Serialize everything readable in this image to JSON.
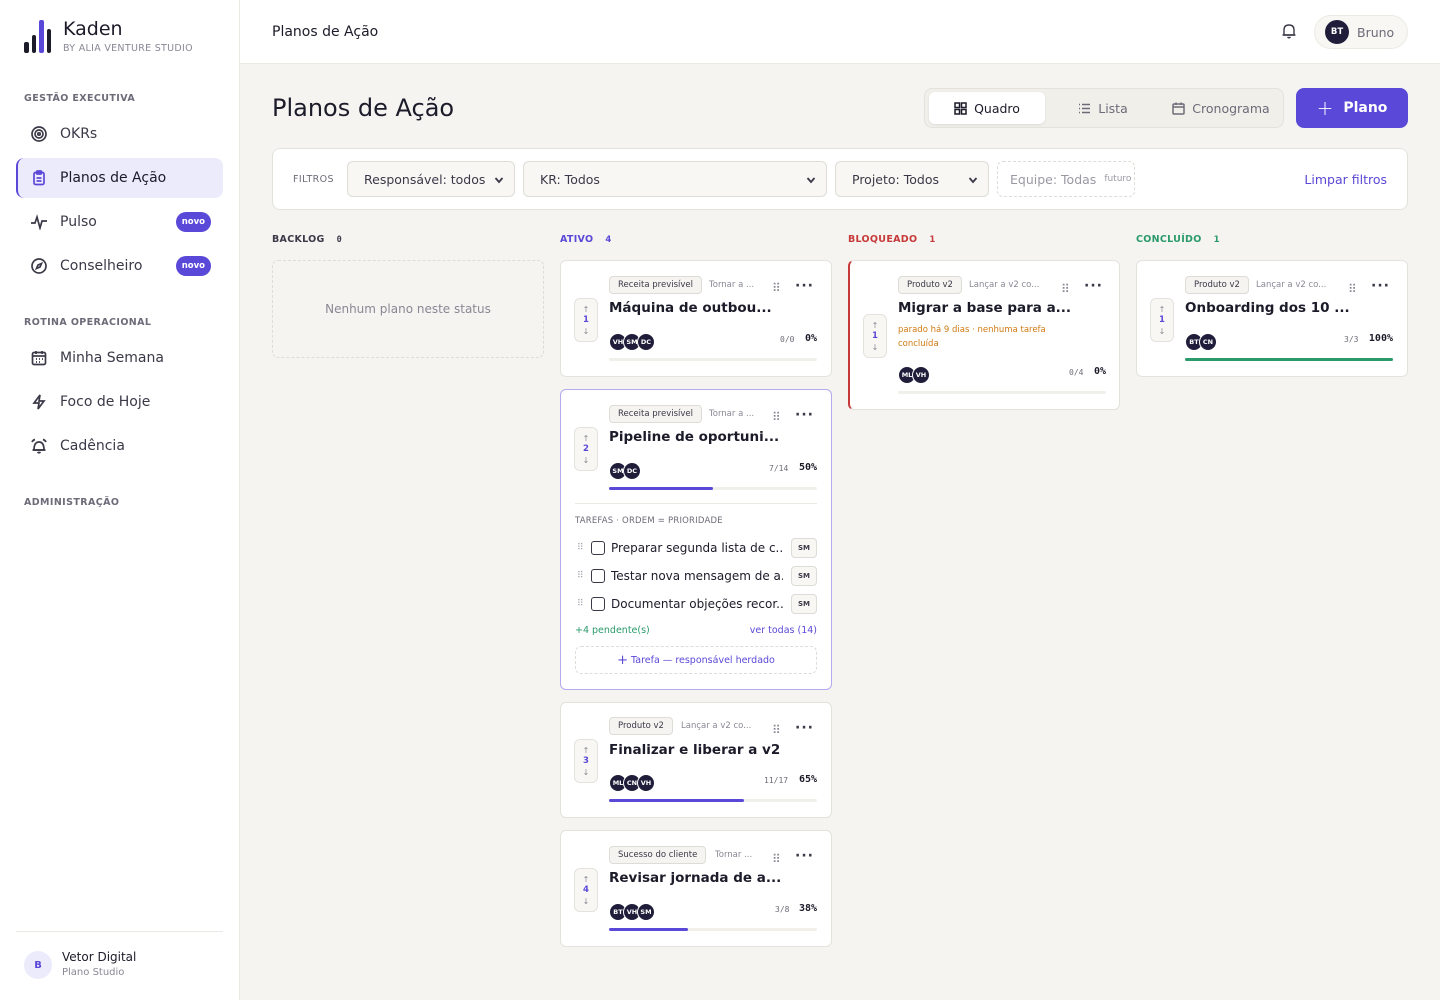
{
  "brand": {
    "name": "Kaden",
    "sub": "BY ALIA VENTURE STUDIO"
  },
  "sidebar": {
    "sections": [
      {
        "title": "GESTÃO EXECUTIVA"
      },
      {
        "title": "ROTINA OPERACIONAL"
      },
      {
        "title": "ADMINISTRAÇÃO"
      }
    ],
    "items": [
      {
        "label": "OKRs",
        "icon": "target-icon"
      },
      {
        "label": "Planos de Ação",
        "icon": "clipboard-icon",
        "active": true
      },
      {
        "label": "Pulso",
        "icon": "activity-icon",
        "badge": "novo"
      },
      {
        "label": "Conselheiro",
        "icon": "compass-icon",
        "badge": "novo"
      },
      {
        "label": "Minha Semana",
        "icon": "calendar-icon"
      },
      {
        "label": "Foco de Hoje",
        "icon": "lightning-icon"
      },
      {
        "label": "Cadência",
        "icon": "alarm-icon"
      }
    ],
    "footer": {
      "initial": "B",
      "name": "Vetor Digital",
      "sub": "Plano Studio"
    }
  },
  "topbar": {
    "breadcrumb": "Planos de Ação",
    "user_initials": "BT",
    "user_name": "Bruno"
  },
  "page": {
    "title": "Planos de Ação"
  },
  "views": {
    "board": "Quadro",
    "list": "Lista",
    "timeline": "Cronograma",
    "active": "Quadro"
  },
  "new_button": {
    "label": "Plano"
  },
  "filters": {
    "label": "FILTROS",
    "responsavel": "Responsável: todos",
    "kr": "KR: Todos",
    "projeto": "Projeto: Todos",
    "equipe": "Equipe: Todas",
    "equipe_tag": "futuro",
    "clear": "Limpar filtros"
  },
  "columns": [
    {
      "title": "BACKLOG",
      "count": "0",
      "color": "#3b3947",
      "empty_text": "Nenhum plano neste status"
    },
    {
      "title": "ATIVO",
      "count": "4",
      "color": "#5a48d8"
    },
    {
      "title": "BLOQUEADO",
      "count": "1",
      "color": "#c73a3a"
    },
    {
      "title": "CONCLUÍDO",
      "count": "1",
      "color": "#2a9a6a"
    }
  ],
  "cards": {
    "a1": {
      "priority": "1",
      "tag": "Receita previsível",
      "tag2": "Tornar a ...",
      "title": "Máquina de outbou...",
      "avatars": [
        "VH",
        "SM",
        "DC"
      ],
      "count": "0/0",
      "pct": "0%",
      "progress": 0
    },
    "a2": {
      "priority": "2",
      "tag": "Receita previsível",
      "tag2": "Tornar a ...",
      "title": "Pipeline de oportuni...",
      "avatars": [
        "SM",
        "DC"
      ],
      "count": "7/14",
      "pct": "50%",
      "progress": 0.5,
      "tasks_title": "TAREFAS · ORDEM = PRIORIDADE",
      "tasks": [
        {
          "text": "Preparar segunda lista de c...",
          "owner": "SM"
        },
        {
          "text": "Testar nova mensagem de a...",
          "owner": "SM"
        },
        {
          "text": "Documentar objeções recor...",
          "owner": "SM"
        }
      ],
      "pending": "+4 pendente(s)",
      "see_all": "ver todas (14)",
      "add_task": "Tarefa — responsável herdado"
    },
    "a3": {
      "priority": "3",
      "tag": "Produto v2",
      "tag2": "Lançar a v2 co...",
      "title": "Finalizar e liberar a v2",
      "avatars": [
        "ML",
        "CN",
        "VH"
      ],
      "count": "11/17",
      "pct": "65%",
      "progress": 0.65
    },
    "a4": {
      "priority": "4",
      "tag": "Sucesso do cliente",
      "tag2": "Tornar ...",
      "title": "Revisar jornada de a...",
      "avatars": [
        "BT",
        "VH",
        "SM"
      ],
      "count": "3/8",
      "pct": "38%",
      "progress": 0.38
    },
    "b1": {
      "priority": "1",
      "tag": "Produto v2",
      "tag2": "Lançar a v2 co...",
      "title": "Migrar a base para a...",
      "warning": "parado há 9 dias · nenhuma tarefa concluída",
      "avatars": [
        "ML",
        "VH"
      ],
      "count": "0/4",
      "pct": "0%",
      "progress": 0
    },
    "c1": {
      "priority": "1",
      "tag": "Produto v2",
      "tag2": "Lançar a v2 co...",
      "title": "Onboarding dos 10 ...",
      "avatars": [
        "BT",
        "CN"
      ],
      "count": "3/3",
      "pct": "100%",
      "progress": 1
    }
  }
}
